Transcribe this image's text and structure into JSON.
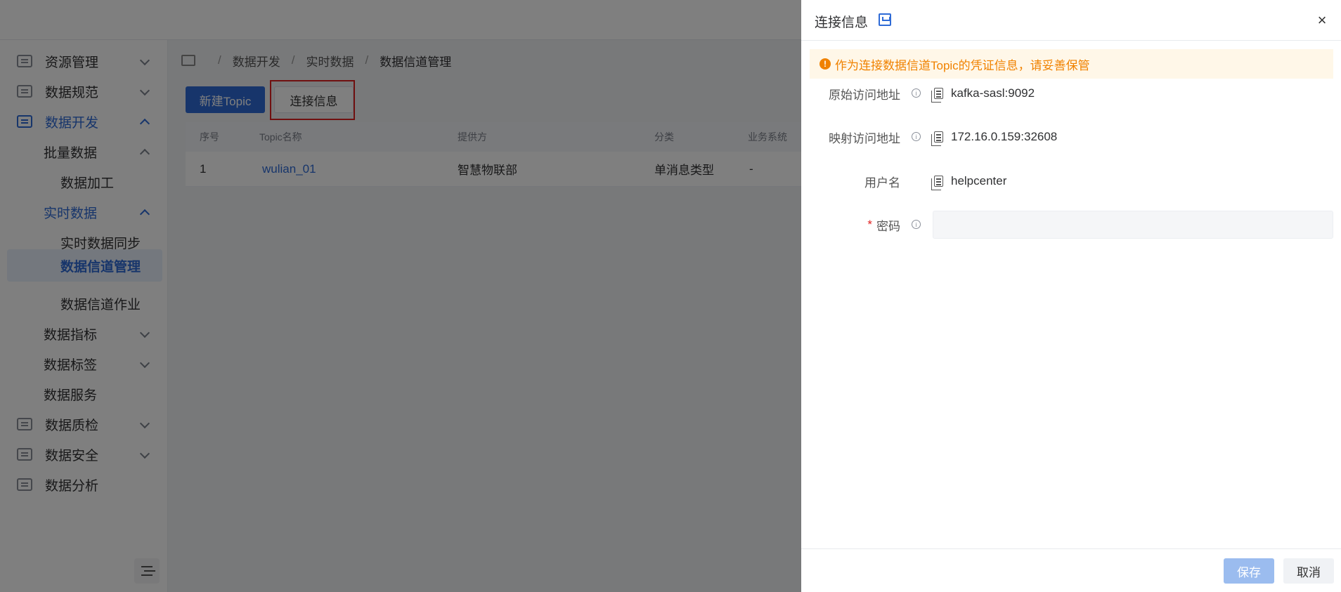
{
  "sidebar": {
    "items": [
      {
        "label": "资源管理"
      },
      {
        "label": "数据规范"
      },
      {
        "label": "数据开发"
      },
      {
        "label": "批量数据"
      },
      {
        "label": "数据加工"
      },
      {
        "label": "实时数据"
      },
      {
        "label": "实时数据同步"
      },
      {
        "label": "数据信道管理"
      },
      {
        "label": "数据信道作业"
      },
      {
        "label": "数据指标"
      },
      {
        "label": "数据标签"
      },
      {
        "label": "数据服务"
      },
      {
        "label": "数据质检"
      },
      {
        "label": "数据安全"
      },
      {
        "label": "数据分析"
      }
    ]
  },
  "breadcrumb": {
    "sep": "/",
    "level1": "数据开发",
    "level2": "实时数据",
    "current": "数据信道管理"
  },
  "toolbar": {
    "new_topic": "新建Topic",
    "connection_info": "连接信息"
  },
  "table": {
    "columns": [
      "序号",
      "Topic名称",
      "提供方",
      "分类",
      "业务系统"
    ],
    "rows": [
      {
        "index": "1",
        "name": "wulian_01",
        "provider": "智慧物联部",
        "category": "单消息类型",
        "system": "-"
      }
    ]
  },
  "drawer": {
    "title": "连接信息",
    "close": "×",
    "alert_icon": "!",
    "alert": "作为连接数据信道Topic的凭证信息，请妥善保管",
    "fields": {
      "origin_label": "原始访问地址",
      "origin_value": "kafka-sasl:9092",
      "mapped_label": "映射访问地址",
      "mapped_value": "172.16.0.159:32608",
      "username_label": "用户名",
      "username_value": "helpcenter",
      "required_mark": "*",
      "password_label": "密码",
      "info_glyph": "i"
    },
    "save": "保存",
    "cancel": "取消"
  },
  "colors": {
    "primary": "#2f6bd6",
    "warning": "#f08200",
    "highlight": "#e02020"
  }
}
